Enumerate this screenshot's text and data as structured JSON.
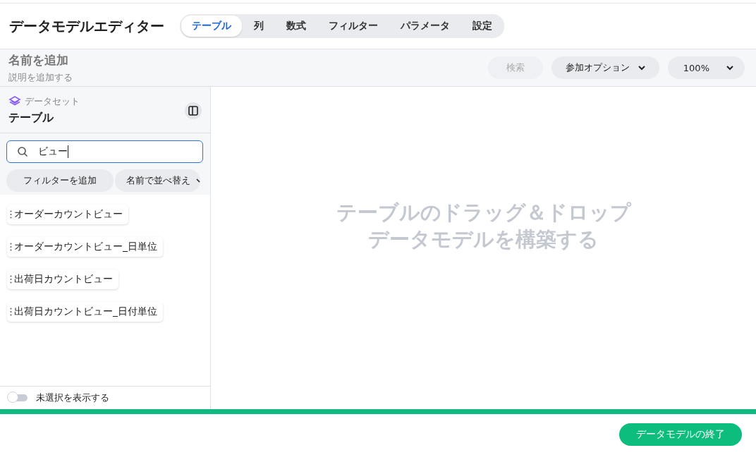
{
  "header": {
    "title": "データモデルエディター",
    "tabs": [
      {
        "label": "テーブル",
        "selected": true
      },
      {
        "label": "列",
        "selected": false
      },
      {
        "label": "数式",
        "selected": false
      },
      {
        "label": "フィルター",
        "selected": false
      },
      {
        "label": "パラメータ",
        "selected": false
      },
      {
        "label": "設定",
        "selected": false
      }
    ]
  },
  "subheader": {
    "name_placeholder": "名前を追加",
    "description_placeholder": "説明を追加する",
    "search_button": {
      "label": "検索",
      "disabled": true
    },
    "join_options": "参加オプション",
    "zoom": "100%"
  },
  "sidebar": {
    "kicker": "データセット",
    "title": "テーブル",
    "search": {
      "value": "ビュー"
    },
    "filter_button": "フィルターを追加",
    "sort_button": "名前で並べ替え",
    "tables": [
      {
        "name": "オーダーカウントビュー"
      },
      {
        "name": "オーダーカウントビュー_日単位"
      },
      {
        "name": "出荷日カウントビュー"
      },
      {
        "name": "出荷日カウントビュー_日付単位"
      }
    ],
    "show_unselected": {
      "label": "未選択を表示する",
      "on": false
    }
  },
  "canvas": {
    "empty_lines": [
      "テーブルのドラッグ＆ドロップ",
      "データモデルを構築する"
    ]
  },
  "footer": {
    "finish_button": "データモデルの終了"
  }
}
